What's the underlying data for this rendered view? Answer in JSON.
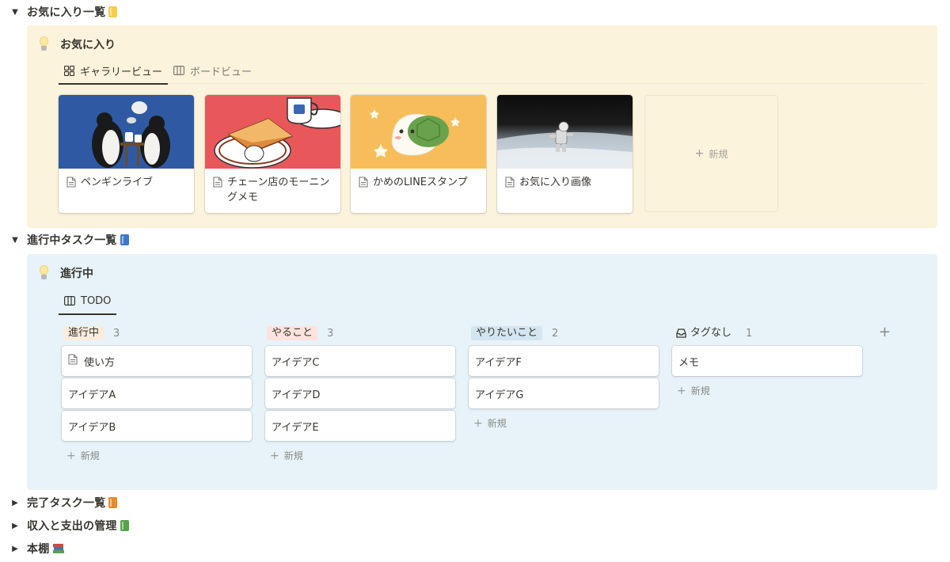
{
  "sections": {
    "favorites": {
      "title": "お気に入り一覧",
      "icon": "yellow-book-icon",
      "color": "#f4cd4a"
    },
    "in_progress": {
      "title": "進行中タスク一覧",
      "icon": "blue-book-icon",
      "color": "#3d76c7"
    },
    "done": {
      "title": "完了タスク一覧",
      "icon": "orange-book-icon",
      "color": "#e78b2e"
    },
    "finance": {
      "title": "収入と支出の管理",
      "icon": "green-book-icon",
      "color": "#5aa14c"
    },
    "bookshelf": {
      "title": "本棚",
      "icon": "books-icon",
      "color": "#7b5ea7"
    }
  },
  "favorites_callout": {
    "title": "お気に入り",
    "tabs": [
      {
        "label": "ギャラリービュー",
        "icon": "gallery-grid-icon"
      },
      {
        "label": "ボードビュー",
        "icon": "board-columns-icon"
      }
    ],
    "cards": [
      {
        "title_line1": "ペンギンライブ",
        "title_line2": "",
        "cover": "penguins-cover"
      },
      {
        "title_line1": "チェーン店のモーニン",
        "title_line2": "グメモ",
        "cover": "breakfast-cover"
      },
      {
        "title_line1": "かめのLINEスタンプ",
        "title_line2": "",
        "cover": "turtle-cover"
      },
      {
        "title_line1": "お気に入り画像",
        "title_line2": "",
        "cover": "astronaut-cover"
      }
    ],
    "new_label": "新規"
  },
  "progress_callout": {
    "title": "進行中",
    "tab_label": "TODO",
    "columns": [
      {
        "label": "進行中",
        "count": "3",
        "tag_color": "#fbecdd",
        "cards": [
          "使い方",
          "アイデアA",
          "アイデアB"
        ]
      },
      {
        "label": "やること",
        "count": "3",
        "tag_color": "#ffe2dd",
        "cards": [
          "アイデアC",
          "アイデアD",
          "アイデアE"
        ]
      },
      {
        "label": "やりたいこと",
        "count": "2",
        "tag_color": "#d3e5ef",
        "cards": [
          "アイデアF",
          "アイデアG"
        ]
      },
      {
        "label": "タグなし",
        "count": "1",
        "tag_color": "transparent",
        "cards": [
          "メモ"
        ]
      }
    ],
    "new_label": "新規",
    "add_column": "+"
  }
}
